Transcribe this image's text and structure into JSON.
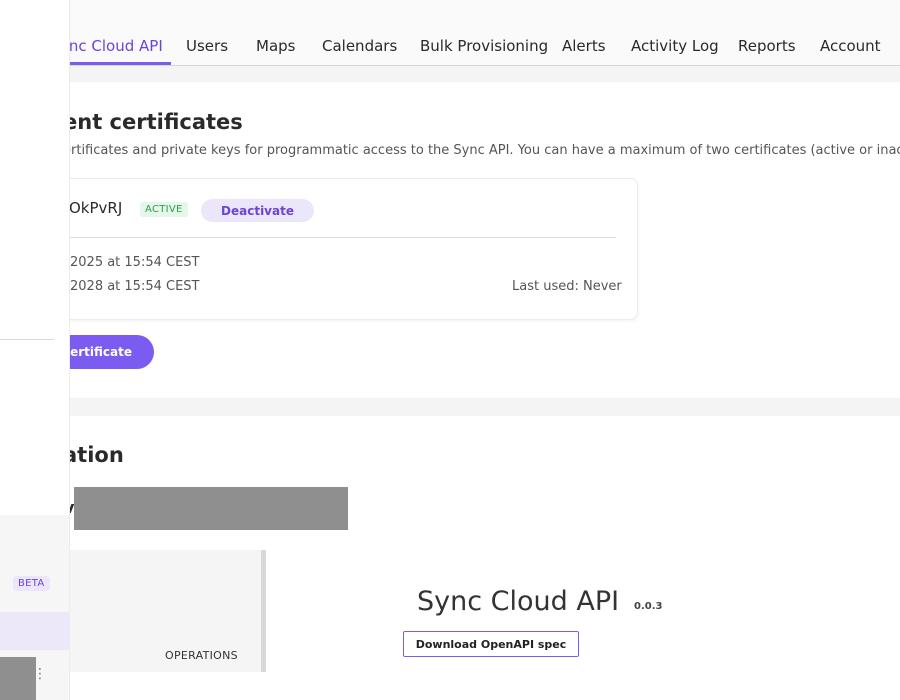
{
  "nav": {
    "tabs": [
      {
        "label": "ync Cloud API",
        "active": true
      },
      {
        "label": "Users"
      },
      {
        "label": "Maps"
      },
      {
        "label": "Calendars"
      },
      {
        "label": "Bulk Provisioning"
      },
      {
        "label": "Alerts"
      },
      {
        "label": "Activity Log"
      },
      {
        "label": "Reports"
      },
      {
        "label": "Account"
      }
    ]
  },
  "sidebar": {
    "beta_badge": "BETA"
  },
  "certificates": {
    "title": "ent certificates",
    "description": "ertificates and private keys for programmatic access to the Sync API. You can have a maximum of two certificates (active or inactive",
    "cert": {
      "id": "OkPvRJ",
      "status": "ACTIVE",
      "deactivate_label": "Deactivate",
      "created": "2025 at 15:54 CEST",
      "expires": "2028 at 15:54 CEST",
      "last_used": "Last used: Never"
    },
    "new_button_label": "certificate"
  },
  "documentation": {
    "title": "ation",
    "subtitle_fragment": "v",
    "operations_label": "OPERATIONS",
    "api_title": "Sync Cloud API",
    "api_version": "0.0.3",
    "download_label": "Download OpenAPI spec"
  },
  "colors": {
    "accent": "#7c5bf0",
    "accent_text": "#6b44d8",
    "active_badge": "#2e9d4a"
  }
}
